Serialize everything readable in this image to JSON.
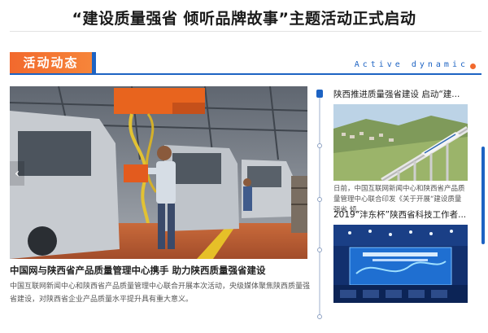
{
  "header": {
    "title": "“建设质量强省 倾听品牌故事”主题活动正式启动"
  },
  "section": {
    "tab_label": "活动动态",
    "subtitle": "Active  dynamic"
  },
  "featured": {
    "headline": "中国网与陕西省产品质量管理中心携手 助力陕西质量强省建设",
    "description": "中国互联网新闻中心和陕西省产品质量管理中心联合开展本次活动，央级媒体聚焦陕西质量强省建设，对陕西省企业产品质量水平提升具有重大意义。",
    "prev_arrow": "‹"
  },
  "news": [
    {
      "title": "陕西推进质量强省建设 启动“建...",
      "excerpt": "日前，中国互联网新闻中心和陕西省产品质量管理中心联合印发《关于开展“建设质量强省 倾..."
    },
    {
      "title": "2019“沣东杯”陕西省科技工作者...",
      "excerpt": ""
    }
  ],
  "colors": {
    "accent_orange": "#f2692d",
    "accent_blue": "#1d63c3"
  }
}
